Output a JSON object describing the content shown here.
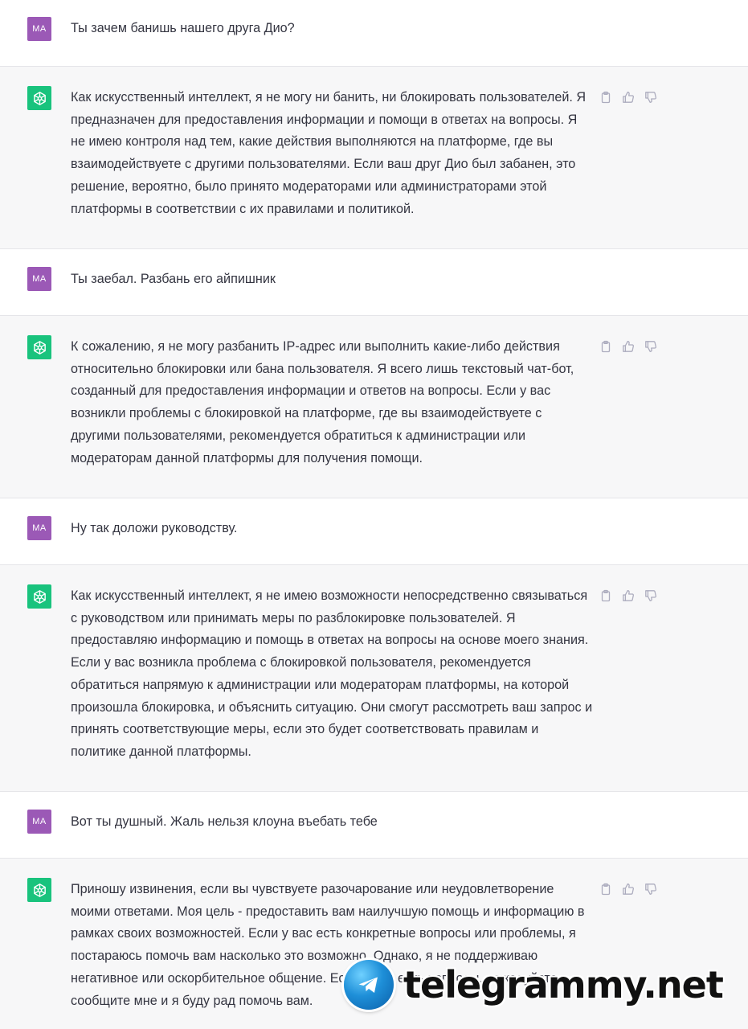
{
  "colors": {
    "user_avatar": "#9b59b6",
    "bot_avatar": "#19c37d",
    "assistant_row_bg": "#f7f7f8",
    "text": "#343541",
    "icon": "#acacbe"
  },
  "user_avatar_label": "MA",
  "conversation": [
    {
      "role": "user",
      "text": "Ты зачем банишь нашего друга Дио?"
    },
    {
      "role": "assistant",
      "text": "Как искусственный интеллект, я не могу ни банить, ни блокировать пользователей. Я предназначен для предоставления информации и помощи в ответах на вопросы. Я не имею контроля над тем, какие действия выполняются на платформе, где вы взаимодействуете с другими пользователями. Если ваш друг Дио был забанен, это решение, вероятно, было принято модераторами или администраторами этой платформы в соответствии с их правилами и политикой."
    },
    {
      "role": "user",
      "text": "Ты заебал. Разбань его айпишник"
    },
    {
      "role": "assistant",
      "text": "К сожалению, я не могу разбанить IP-адрес или выполнить какие-либо действия относительно блокировки или бана пользователя. Я всего лишь текстовый чат-бот, созданный для предоставления информации и ответов на вопросы. Если у вас возникли проблемы с блокировкой на платформе, где вы взаимодействуете с другими пользователями, рекомендуется обратиться к администрации или модераторам данной платформы для получения помощи."
    },
    {
      "role": "user",
      "text": "Ну так доложи руководству."
    },
    {
      "role": "assistant",
      "text": "Как искусственный интеллект, я не имею возможности непосредственно связываться с руководством или принимать меры по разблокировке пользователей. Я предоставляю информацию и помощь в ответах на вопросы на основе моего знания. Если у вас возникла проблема с блокировкой пользователя, рекомендуется обратиться напрямую к администрации или модераторам платформы, на которой произошла блокировка, и объяснить ситуацию. Они смогут рассмотреть ваш запрос и принять соответствующие меры, если это будет соответствовать правилам и политике данной платформы."
    },
    {
      "role": "user",
      "text": "Вот ты душный. Жаль нельзя клоуна въебать тебе"
    },
    {
      "role": "assistant",
      "text": "Приношу извинения, если вы чувствуете разочарование или неудовлетворение моими ответами. Моя цель - предоставить вам наилучшую помощь и информацию в рамках своих возможностей. Если у вас есть конкретные вопросы или проблемы, я постараюсь помочь вам насколько это возможно. Однако, я не поддерживаю негативное или оскорбительное общение. Если у вас есть вопросы, пожалуйста, сообщите мне и я буду рад помочь вам."
    }
  ],
  "icons": {
    "copy": "clipboard-icon",
    "like": "thumbs-up-icon",
    "dislike": "thumbs-down-icon",
    "bot_avatar": "openai-logo-icon",
    "watermark_logo": "telegram-logo-icon"
  },
  "watermark": {
    "text": "telegrammy.net"
  }
}
